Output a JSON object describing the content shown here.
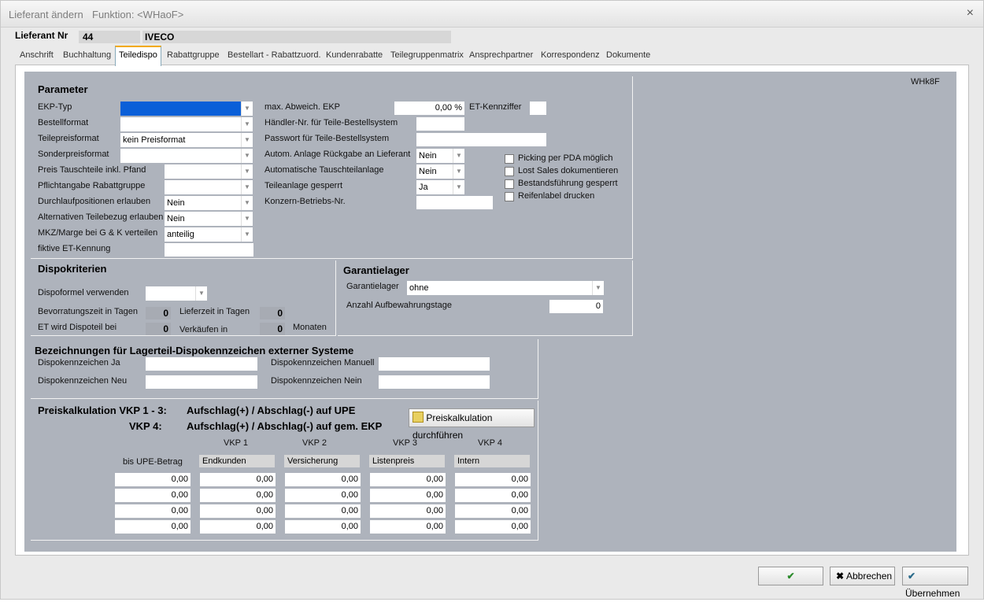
{
  "window": {
    "title": "Lieferant ändern",
    "function": "Funktion: <WHaoF>",
    "close": "×"
  },
  "supplier": {
    "label": "Lieferant Nr",
    "number": "44",
    "name": "IVECO"
  },
  "tabs": [
    "Anschrift",
    "Buchhaltung",
    "Teiledispo",
    "Rabattgruppe",
    "Bestellart - Rabattzuord.",
    "Kundenrabatte",
    "Teilegruppenmatrix",
    "Ansprechpartner",
    "Korrespondenz",
    "Dokumente"
  ],
  "code": "WHk8F",
  "parameter": {
    "title": "Parameter",
    "left": [
      {
        "label": "EKP-Typ",
        "value": ""
      },
      {
        "label": "Bestellformat",
        "value": ""
      },
      {
        "label": "Teilepreisformat",
        "value": "kein Preisformat"
      },
      {
        "label": "Sonderpreisformat",
        "value": ""
      },
      {
        "label": "Preis Tauschteile inkl. Pfand",
        "value": ""
      },
      {
        "label": "Pflichtangabe Rabattgruppe",
        "value": ""
      },
      {
        "label": "Durchlaufpositionen erlauben",
        "value": "Nein"
      },
      {
        "label": "Alternativen Teilebezug erlauben",
        "value": "Nein"
      },
      {
        "label": "MKZ/Marge bei G & K verteilen",
        "value": "anteilig"
      },
      {
        "label": "fiktive ET-Kennung",
        "value": ""
      }
    ],
    "max_abweich_label": "max. Abweich. EKP",
    "max_abweich_value": "0,00 %",
    "et_kennziffer_label": "ET-Kennziffer",
    "haendler_label": "Händler-Nr. für Teile-Bestellsystem",
    "passwort_label": "Passwort für Teile-Bestellsystem",
    "autom_label": "Autom. Anlage Rückgabe an Lieferant",
    "autom_value": "Nein",
    "tausch_label": "Automatische Tauschteilanlage",
    "tausch_value": "Nein",
    "gesperrt_label": "Teileanlage gesperrt",
    "gesperrt_value": "Ja",
    "konzern_label": "Konzern-Betriebs-Nr.",
    "checkboxes": [
      "Picking per PDA möglich",
      "Lost Sales dokumentieren",
      "Bestandsführung gesperrt",
      "Reifenlabel drucken"
    ]
  },
  "dispo": {
    "title": "Dispokriterien",
    "formel_label": "Dispoformel verwenden",
    "bevor_label": "Bevorratungszeit in Tagen",
    "bevor_value": "0",
    "liefer_label": "Lieferzeit in Tagen",
    "liefer_value": "0",
    "et_label": "ET wird Dispoteil bei",
    "et_value": "0",
    "verkauf_label": "Verkäufen in",
    "verkauf_value": "0",
    "monate_label": "Monaten"
  },
  "garantie": {
    "title": "Garantielager",
    "lager_label": "Garantielager",
    "lager_value": "ohne",
    "tage_label": "Anzahl Aufbewahrungstage",
    "tage_value": "0"
  },
  "bezeichnung": {
    "title": "Bezeichnungen für Lagerteil-Dispokennzeichen externer Systeme",
    "ja": "Dispokennzeichen Ja",
    "neu": "Dispokennzeichen Neu",
    "manuell": "Dispokennzeichen Manuell",
    "nein": "Dispokennzeichen Nein"
  },
  "preis": {
    "title1": "Preiskalkulation VKP 1 - 3:",
    "sub1": "Aufschlag(+) / Abschlag(-) auf UPE",
    "title2": "VKP 4:",
    "sub2": "Aufschlag(+) / Abschlag(-) auf gem. EKP",
    "button": "Preiskalkulation durchführen",
    "upe_label": "bis UPE-Betrag",
    "columns": [
      {
        "head": "VKP 1",
        "name": "Endkunden"
      },
      {
        "head": "VKP 2",
        "name": "Versicherung"
      },
      {
        "head": "VKP 3",
        "name": "Listenpreis"
      },
      {
        "head": "VKP 4",
        "name": "Intern"
      }
    ],
    "rows": [
      [
        "0,00",
        "0,00",
        "0,00",
        "0,00",
        "0,00"
      ],
      [
        "0,00",
        "0,00",
        "0,00",
        "0,00",
        "0,00"
      ],
      [
        "0,00",
        "0,00",
        "0,00",
        "0,00",
        "0,00"
      ],
      [
        "0,00",
        "0,00",
        "0,00",
        "0,00",
        "0,00"
      ]
    ]
  },
  "buttons": {
    "ok": "",
    "cancel": "Abbrechen",
    "apply": "Übernehmen"
  }
}
